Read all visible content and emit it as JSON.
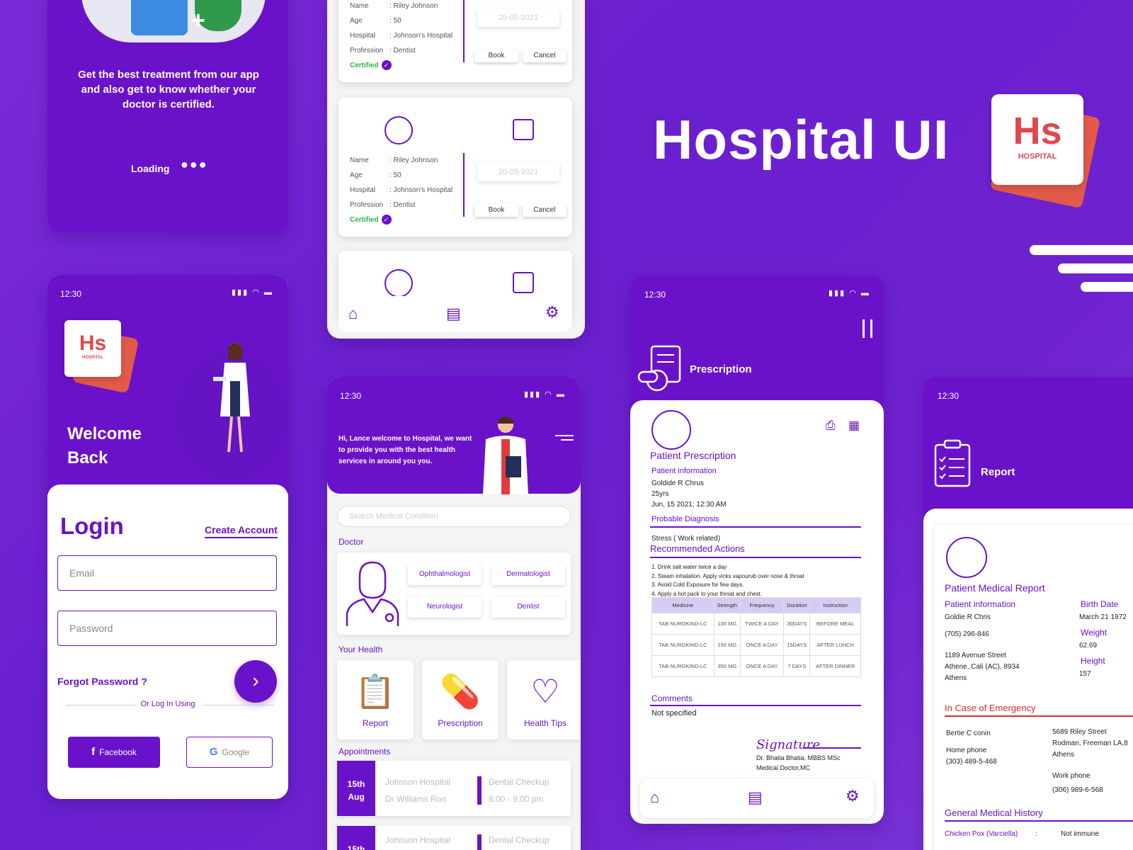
{
  "hero": {
    "title": "Hospital UI"
  },
  "logo": {
    "mark": "Hs",
    "subtitle": "HOSPITAL"
  },
  "splash": {
    "tagline": "Get the best treatment from our app and also get to know whether your doctor is certified.",
    "loading": "Loading",
    "dots": "●●●"
  },
  "status": {
    "time": "12:30",
    "icons": "▮▮▮ ◠ ▬"
  },
  "login": {
    "welcome_1": "Welcome",
    "welcome_2": "Back",
    "title": "Login",
    "create_account": "Create Account",
    "email_placeholder": "Email",
    "password_placeholder": "Password",
    "forgot": "Forgot Password ?",
    "or_text": "Or Log In Using",
    "facebook": "Facebook",
    "google": "Google"
  },
  "booking": {
    "labels": {
      "name": "Name",
      "age": "Age",
      "hospital": "Hospital",
      "profession": "Profession"
    },
    "cards": [
      {
        "name": ": Riley Johnson",
        "age": ":   50",
        "hospital": ": Johnson's Hospital",
        "profession": ": Dentist",
        "certified": "Certified",
        "date": "20-05-2021",
        "book": "Book",
        "cancel": "Cancel"
      },
      {
        "name": ": Riley Johnson",
        "age": ":   50",
        "hospital": ": Johnson's Hospital",
        "profession": ": Dentist",
        "certified": "Certified",
        "date": "20-05-2021",
        "book": "Book",
        "cancel": "Cancel"
      }
    ]
  },
  "home": {
    "greeting": "Hi, Lance welcome to Hospital, we want to provide you with the best health services in around you you.",
    "search_placeholder": "Search Medical Condition",
    "doctor_label": "Doctor",
    "specialties": [
      "Ophthalmologist",
      "Dermatologist",
      "Neurologist",
      "Dentist"
    ],
    "your_health_label": "Your Health",
    "health_cards": [
      "Report",
      "Prescription",
      "Health Tips"
    ],
    "appointments_label": "Appointments",
    "appointments": [
      {
        "day": "15th",
        "month": "Aug",
        "hospital": "Johnson Hospital",
        "doctor": "Dr Williams Ron",
        "type": "Dental Checkup",
        "time": "8:00 - 9:00 pm"
      },
      {
        "day": "15th",
        "month": "",
        "hospital": "Johnson Hospital",
        "doctor": "",
        "type": "Dental Checkup",
        "time": ""
      }
    ]
  },
  "prescription": {
    "header": "Prescription",
    "title": "Patient Prescription",
    "patient_info_label": "Patient information",
    "patient_name": "Goldide R Chrus",
    "patient_age": "25yrs",
    "patient_date": "Jun, 15 2021; 12:30 AM",
    "diagnosis_label": "Probable Diagnosis",
    "diagnosis": "Stress ( Work related)",
    "actions_label": "Recommended Actions",
    "actions": [
      "1. Drink salt water twice a day",
      "2. Steam inhalation. Apply vicks vapourub over nose & throat",
      "3. Avoid Cold Exposure for  few days.",
      "4. Apply a hot pack to your throat and chest."
    ],
    "table_headers": [
      "Medicine",
      "Strength",
      "Frequency",
      "Duration",
      "Instruction"
    ],
    "table_rows": [
      [
        "TAB NUROKIND-LC",
        "100 MG",
        "TWICE A DAY",
        "30DAYS",
        "BEFORE MEAL"
      ],
      [
        "TAB NUROKIND-LC",
        "150 MG",
        "ONCE A DAY",
        "15DAYS",
        "AFTER LUNCH"
      ],
      [
        "TAB NUROKIND-LC",
        "350 MG",
        "ONCE A DAY",
        "7 DAYS",
        "AFTER DINNER"
      ]
    ],
    "comments_label": "Comments",
    "comments": "Not specified",
    "signature": "Signature",
    "doctor": "Dr. Bhatia Bhatia, MBBS MSc",
    "doctor_title": "Medical Doctor,MC"
  },
  "report": {
    "header": "Report",
    "title": "Patient Medical Report",
    "patient_info_label": "Patient information",
    "patient_name": "Goldie R Chris",
    "phone": "(705) 296-846",
    "address_1": "1189 Avenue Street",
    "address_2": "Athene, Cali (AC), 8934",
    "address_3": "Athens",
    "birth_label": "Birth Date",
    "birth": "March 21 1972",
    "weight_label": "Weight",
    "weight": "62.69",
    "height_label": "Height",
    "height": "157",
    "emergency_label": "In Case of Emergency",
    "em_name": "Bertie C conin",
    "em_home_label": "Home phone",
    "em_home": "(303) 489-5-468",
    "em_addr_1": "5689 Riley Street",
    "em_addr_2": "Rodman, Freeman LA,8",
    "em_addr_3": "Athens",
    "em_work_label": "Work phone",
    "em_work": "(306) 989-6-568",
    "history_label": "General Medical History",
    "history_item": "Chicken Pox (Varciella)",
    "history_sep": ":",
    "history_value": "Not immune"
  },
  "colors": {
    "brand": "#6a12c9",
    "logo_red": "#e0474e",
    "certified_green": "#2bb34a"
  }
}
